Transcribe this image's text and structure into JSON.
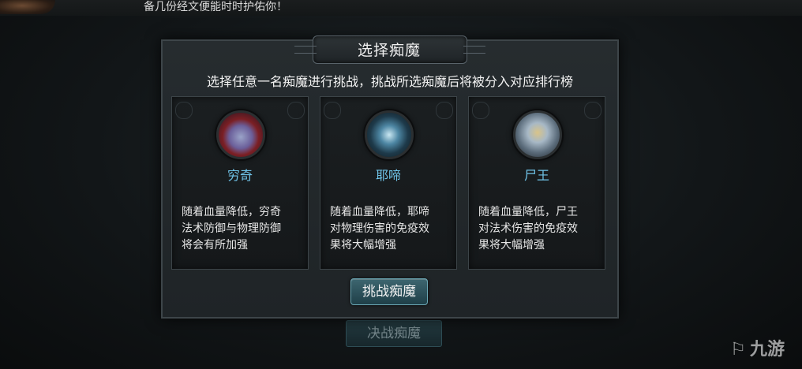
{
  "top_banner": {
    "text": "备几份经文便能时时护佑你！"
  },
  "background_button": {
    "label": "决战痴魔"
  },
  "modal": {
    "title": "选择痴魔",
    "subtitle": "选择任意一名痴魔进行挑战，挑战所选痴魔后将被分入对应排行榜",
    "cards": [
      {
        "name": "穷奇",
        "desc_lines": [
          "随着血量降低，穷奇",
          "法术防御与物理防御",
          "将会有所加强"
        ],
        "icon": "qiongqi-portrait-icon"
      },
      {
        "name": "耶啼",
        "desc_lines": [
          "随着血量降低，耶啼",
          "对物理伤害的免疫效",
          "果将大幅增强"
        ],
        "icon": "yeti-portrait-icon"
      },
      {
        "name": "尸王",
        "desc_lines": [
          "随着血量降低，尸王",
          "对法术伤害的免疫效",
          "果将大幅增强"
        ],
        "icon": "shiwang-portrait-icon"
      }
    ],
    "challenge_button": "挑战痴魔"
  },
  "watermark": {
    "text": "九游"
  },
  "colors": {
    "name_accent": "#6fc3e8",
    "button_teal": "#3d6670"
  }
}
